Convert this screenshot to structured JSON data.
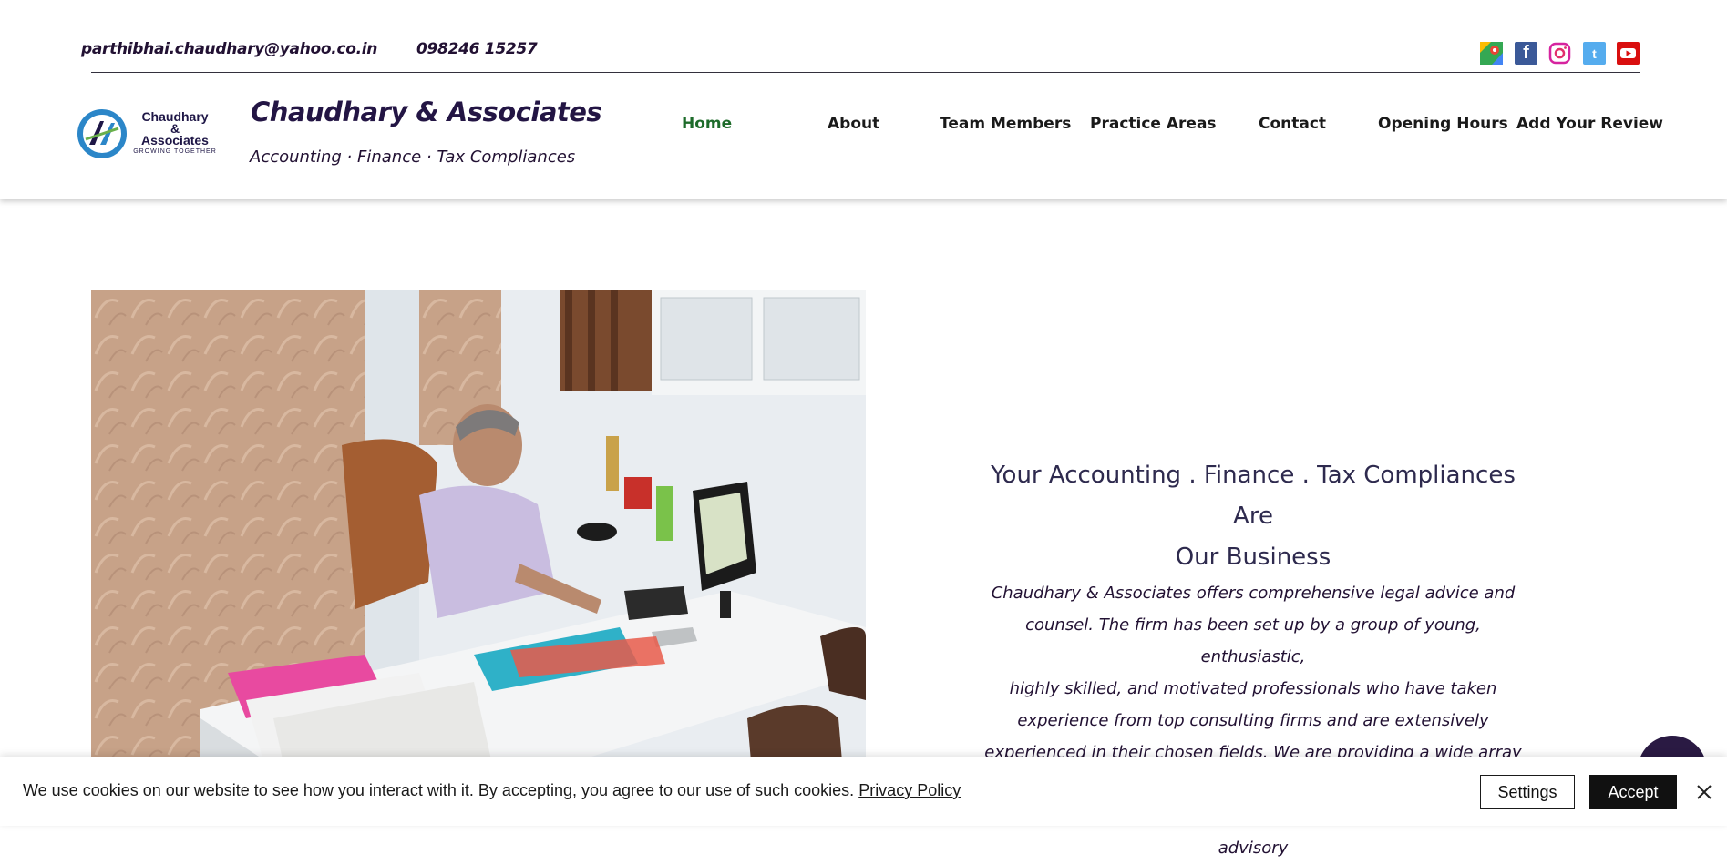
{
  "contact": {
    "email": "parthibhai.chaudhary@yahoo.co.in",
    "phone": "098246 15257"
  },
  "social": [
    {
      "icon": "google-maps-icon",
      "color": "#34a853"
    },
    {
      "icon": "facebook-icon",
      "color": "#3b5998"
    },
    {
      "icon": "instagram-icon",
      "color": "#e1306c"
    },
    {
      "icon": "twitter-icon",
      "color": "#55acee"
    },
    {
      "icon": "youtube-icon",
      "color": "#d90f0f"
    }
  ],
  "logo": {
    "line1": "Chaudhary",
    "line2": "&",
    "line3": "Associates",
    "line4": "GROWING TOGETHER"
  },
  "brand": {
    "name": "Chaudhary & Associates",
    "tagline": "Accounting · Finance · Tax Compliances"
  },
  "nav": {
    "items": [
      {
        "label": "Home",
        "active": true
      },
      {
        "label": "About"
      },
      {
        "label": "Team Members"
      },
      {
        "label": "Practice Areas"
      },
      {
        "label": "Contact"
      },
      {
        "label": "Opening Hours"
      },
      {
        "label": "Add Your Review"
      }
    ]
  },
  "hero": {
    "headline_line1": "Your Accounting . Finance . Tax Compliances Are",
    "headline_line2": "Our Business",
    "paragraph_lines": [
      "Chaudhary & Associates offers comprehensive legal advice and",
      "counsel. The firm has been set up by a group of young, enthusiastic,",
      "highly skilled, and motivated professionals who have taken",
      "experience from top consulting firms and are extensively",
      "experienced in their chosen fields. We are providing a wide array of",
      "Accounting, Auditing & Assurance, Taxation, and Business advisory"
    ]
  },
  "cookie": {
    "text": "We use cookies on our website to see how you interact with it. By accepting, you agree to our use of such cookies.",
    "policy_link": "Privacy Policy",
    "settings_label": "Settings",
    "accept_label": "Accept"
  },
  "colors": {
    "brand_dark": "#231544",
    "nav_active": "#1d6b2a",
    "accent_chat": "#2a1a43"
  }
}
